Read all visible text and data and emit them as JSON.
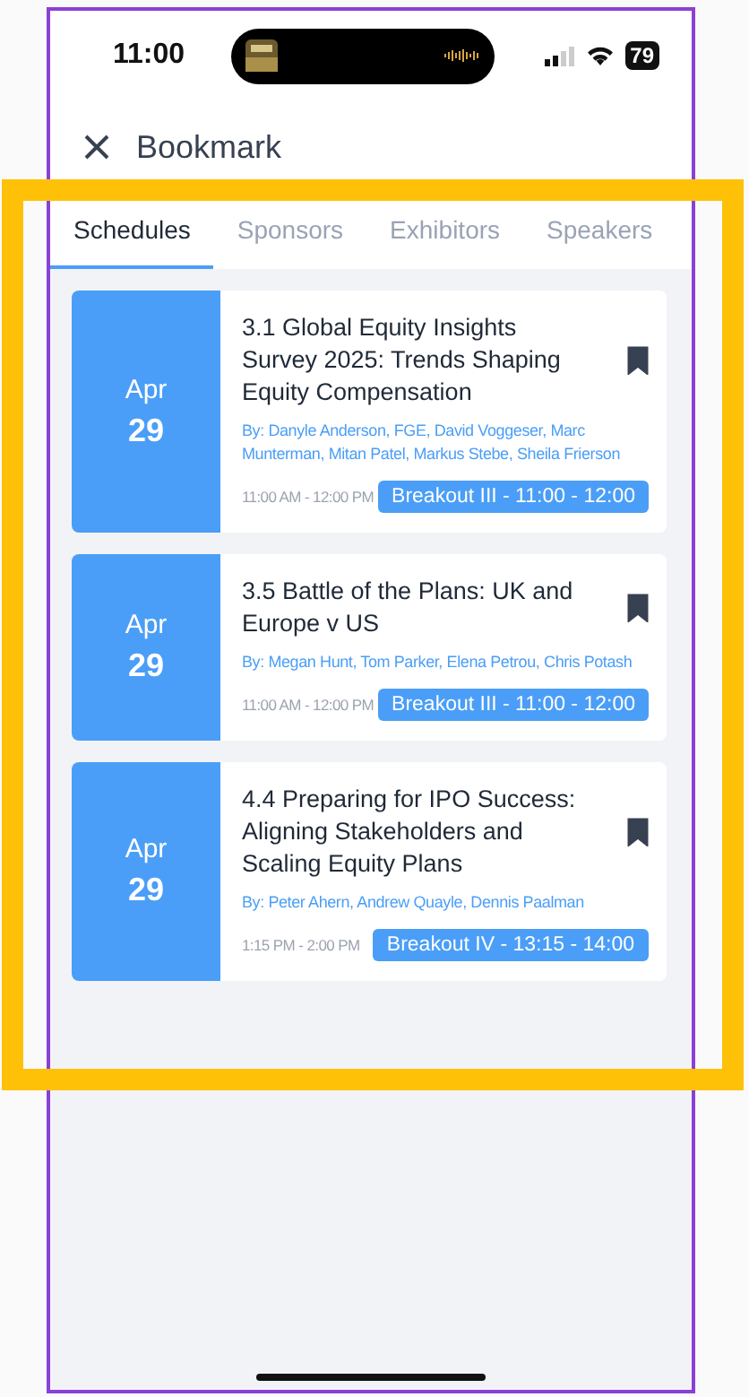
{
  "status_bar": {
    "time": "11:00",
    "battery": "79"
  },
  "header": {
    "title": "Bookmark"
  },
  "tabs": [
    {
      "label": "Schedules",
      "selected": true
    },
    {
      "label": "Sponsors",
      "selected": false
    },
    {
      "label": "Exhibitors",
      "selected": false
    },
    {
      "label": "Speakers",
      "selected": false
    }
  ],
  "sessions": [
    {
      "month": "Apr",
      "day": "29",
      "title": "3.1 Global Equity Insights Survey 2025: Trends Shaping Equity Compensation",
      "speakers": "By: Danyle Anderson, FGE, David Voggeser, Marc Munterman, Mitan Patel, Markus Stebe, Sheila Frierson",
      "time": "11:00 AM - 12:00 PM",
      "room": "Breakout III - 11:00 - 12:00",
      "bookmarked": true
    },
    {
      "month": "Apr",
      "day": "29",
      "title": "3.5 Battle of the Plans: UK and Europe v US",
      "speakers": "By: Megan Hunt, Tom Parker, Elena Petrou, Chris Potash",
      "time": "11:00 AM - 12:00 PM",
      "room": "Breakout III - 11:00 - 12:00",
      "bookmarked": true
    },
    {
      "month": "Apr",
      "day": "29",
      "title": "4.4 Preparing for IPO Success: Aligning Stakeholders and Scaling Equity Plans",
      "speakers": "By: Peter Ahern, Andrew Quayle, Dennis Paalman",
      "time": "1:15 PM - 2:00 PM",
      "room": "Breakout IV - 13:15 - 14:00",
      "bookmarked": true
    }
  ]
}
